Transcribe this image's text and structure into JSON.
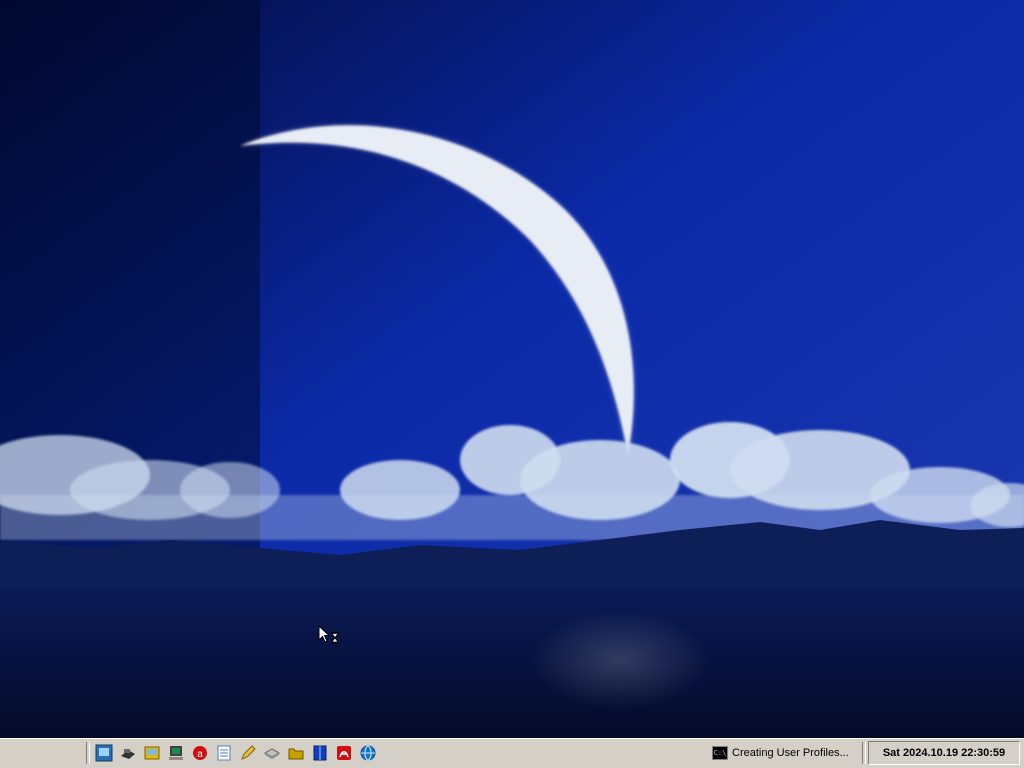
{
  "desktop": {
    "wallpaper": "crescent-moon-over-clouds-and-lake",
    "colors": {
      "sky_top": "#020a3a",
      "sky_mid": "#0b2aa8",
      "sky_bottom": "#1c3ab0",
      "moon": "#e8ecf4",
      "clouds": "#cfdcf0",
      "mountains": "#0e1f58",
      "water": "#06123e"
    },
    "cursor": "arrow-hourglass-busy-cursor"
  },
  "taskbar": {
    "background": "#d4d0c8",
    "quick_launch": [
      {
        "name": "desktop-icon",
        "color": "#2a6fb0"
      },
      {
        "name": "network-icon",
        "color": "#333333"
      },
      {
        "name": "explorer-icon",
        "color": "#e6b800"
      },
      {
        "name": "my-computer-icon",
        "color": "#404040"
      },
      {
        "name": "antivirus-icon",
        "color": "#d01010"
      },
      {
        "name": "notepad-icon",
        "color": "#4a7fc0"
      },
      {
        "name": "edit-icon",
        "color": "#e0c040"
      },
      {
        "name": "drive-icon",
        "color": "#909090"
      },
      {
        "name": "folder-icon",
        "color": "#c8a000"
      },
      {
        "name": "book-icon",
        "color": "#1040c0"
      },
      {
        "name": "pdf-icon",
        "color": "#d01010"
      },
      {
        "name": "globe-icon",
        "color": "#1878c8"
      }
    ],
    "task": {
      "icon": "command-prompt-icon",
      "icon_text": "C:\\",
      "label": "Creating User Profiles..."
    },
    "clock": "Sat 2024.10.19 22:30:59"
  }
}
